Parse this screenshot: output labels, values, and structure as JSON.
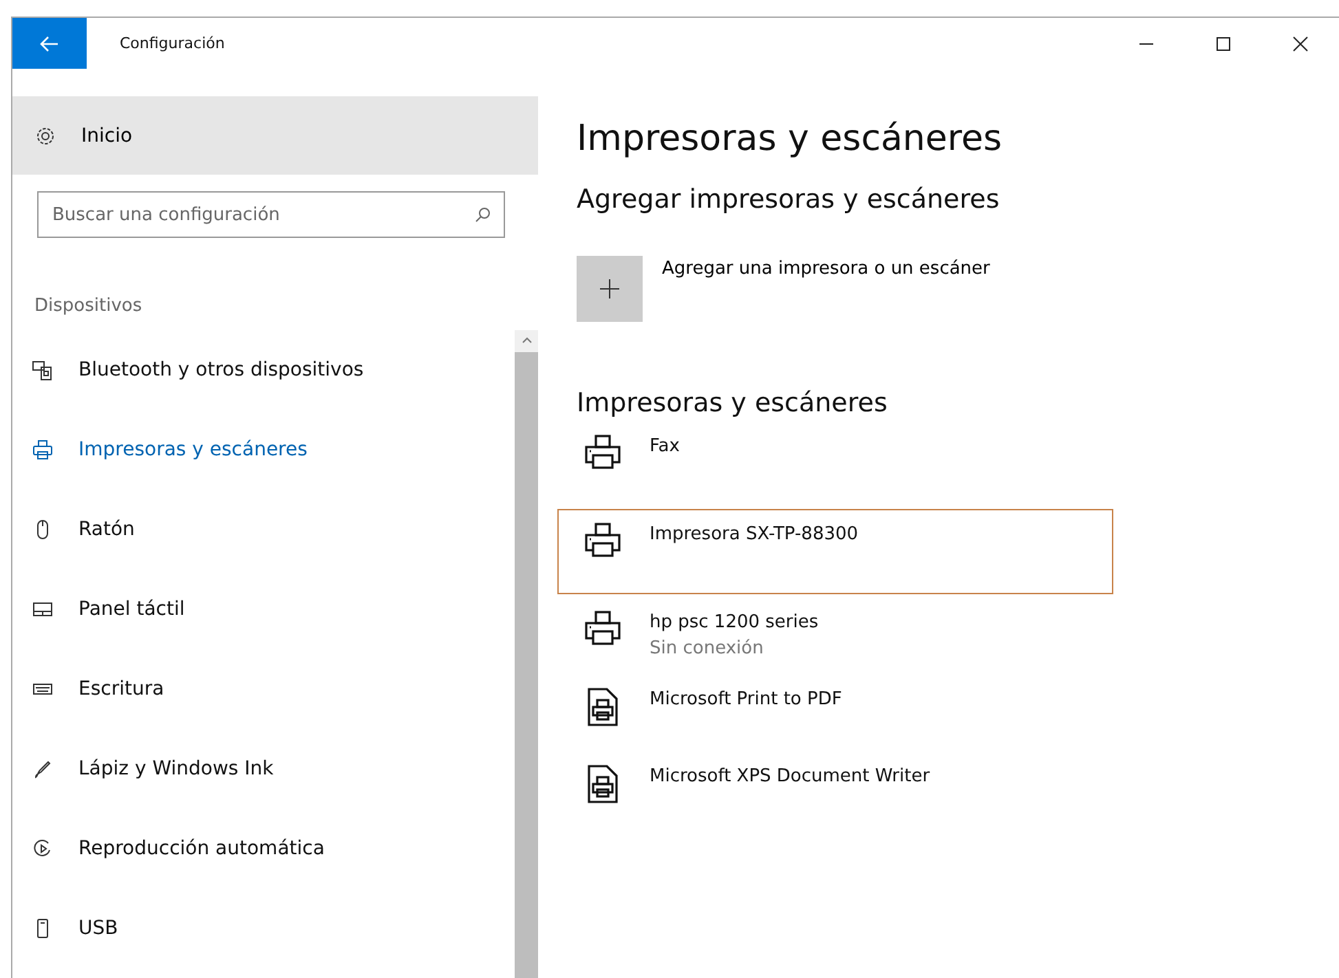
{
  "window": {
    "title": "Configuración"
  },
  "sidebar": {
    "home": "Inicio",
    "search": {
      "placeholder": "Buscar una configuración"
    },
    "section": "Dispositivos",
    "items": [
      {
        "label": "Bluetooth y otros dispositivos",
        "selected": false
      },
      {
        "label": "Impresoras y escáneres",
        "selected": true
      },
      {
        "label": "Ratón",
        "selected": false
      },
      {
        "label": "Panel táctil",
        "selected": false
      },
      {
        "label": "Escritura",
        "selected": false
      },
      {
        "label": "Lápiz y Windows Ink",
        "selected": false
      },
      {
        "label": "Reproducción automática",
        "selected": false
      },
      {
        "label": "USB",
        "selected": false
      }
    ]
  },
  "page": {
    "title": "Impresoras y escáneres",
    "add_heading": "Agregar impresoras y escáneres",
    "add_button": "Agregar una impresora o un escáner",
    "list_heading": "Impresoras y escáneres",
    "devices": [
      {
        "name": "Fax",
        "kind": "printer",
        "selected": false
      },
      {
        "name": "Impresora SX-TP-88300",
        "kind": "printer",
        "selected": true
      },
      {
        "name": "hp psc 1200 series",
        "status": "Sin conexión",
        "kind": "printer",
        "selected": false
      },
      {
        "name": "Microsoft Print to PDF",
        "kind": "document",
        "selected": false
      },
      {
        "name": "Microsoft XPS Document Writer",
        "kind": "document",
        "selected": false
      }
    ]
  }
}
